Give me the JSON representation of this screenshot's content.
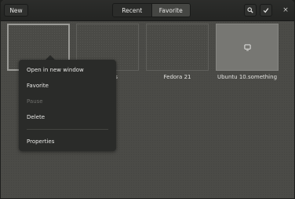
{
  "header": {
    "new_label": "New",
    "tabs": [
      {
        "label": "Recent",
        "selected": false
      },
      {
        "label": "Favorite",
        "selected": true
      }
    ],
    "search_icon": "search-icon",
    "check_icon": "checkmark-icon",
    "close_label": "×"
  },
  "boxes": [
    {
      "label": "",
      "selected": true
    },
    {
      "label": "tinuous"
    },
    {
      "label": "Fedora 21"
    },
    {
      "label": "Ubuntu 10.something",
      "icon": "monitor-icon"
    }
  ],
  "context_menu": {
    "items": [
      {
        "label": "Open in new window",
        "enabled": true
      },
      {
        "label": "Favorite",
        "enabled": true
      },
      {
        "label": "Pause",
        "enabled": false
      },
      {
        "label": "Delete",
        "enabled": true
      },
      {
        "label": "Properties",
        "enabled": true
      }
    ]
  },
  "colors": {
    "headerbar": "#2a2b29",
    "background": "#4a4a46",
    "menu": "#2a2b29"
  }
}
